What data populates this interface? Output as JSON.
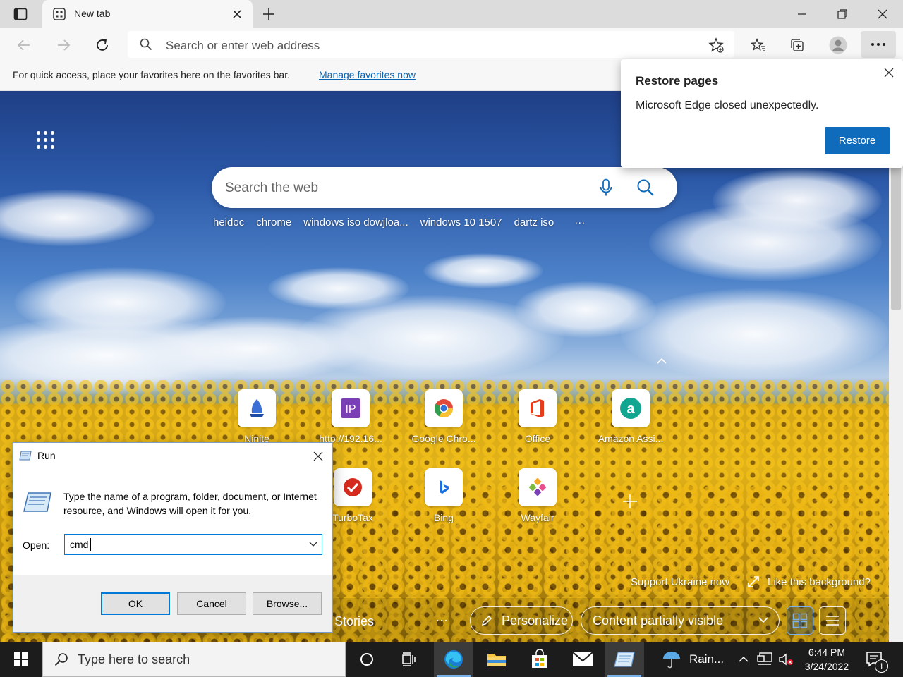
{
  "browser": {
    "tab_title": "New tab",
    "address_placeholder": "Search or enter web address",
    "favorites_bar_message": "For quick access, place your favorites here on the favorites bar.",
    "favorites_bar_link": "Manage favorites now"
  },
  "restore_popup": {
    "title": "Restore pages",
    "body": "Microsoft Edge closed unexpectedly.",
    "button": "Restore"
  },
  "newtab": {
    "search_placeholder": "Search the web",
    "suggestions": [
      "heidoc",
      "chrome",
      "windows iso dowjloa...",
      "windows 10 1507",
      "dartz iso"
    ],
    "suggestions_more": "···",
    "tiles_row1": [
      "Ninite",
      "http://192.16...",
      "Google Chro...",
      "Office",
      "Amazon Assi..."
    ],
    "tiles_row2": [
      "TurboTax",
      "Bing",
      "Wayfair"
    ],
    "support_link": "Support Ukraine now",
    "like_background": "Like this background?",
    "top_stories": "Top Stories",
    "more_dots": "···",
    "personalize": "Personalize",
    "content_visibility": "Content partially visible"
  },
  "run_dialog": {
    "title": "Run",
    "description": "Type the name of a program, folder, document, or Internet resource, and Windows will open it for you.",
    "open_label": "Open:",
    "open_value": "cmd",
    "ok": "OK",
    "cancel": "Cancel",
    "browse": "Browse..."
  },
  "taskbar": {
    "search_placeholder": "Type here to search",
    "weather": "Rain...",
    "time": "6:44 PM",
    "date": "3/24/2022",
    "notification_count": "1"
  },
  "colors": {
    "accent": "#0f6cbd",
    "taskbar": "#1c1c1c"
  }
}
